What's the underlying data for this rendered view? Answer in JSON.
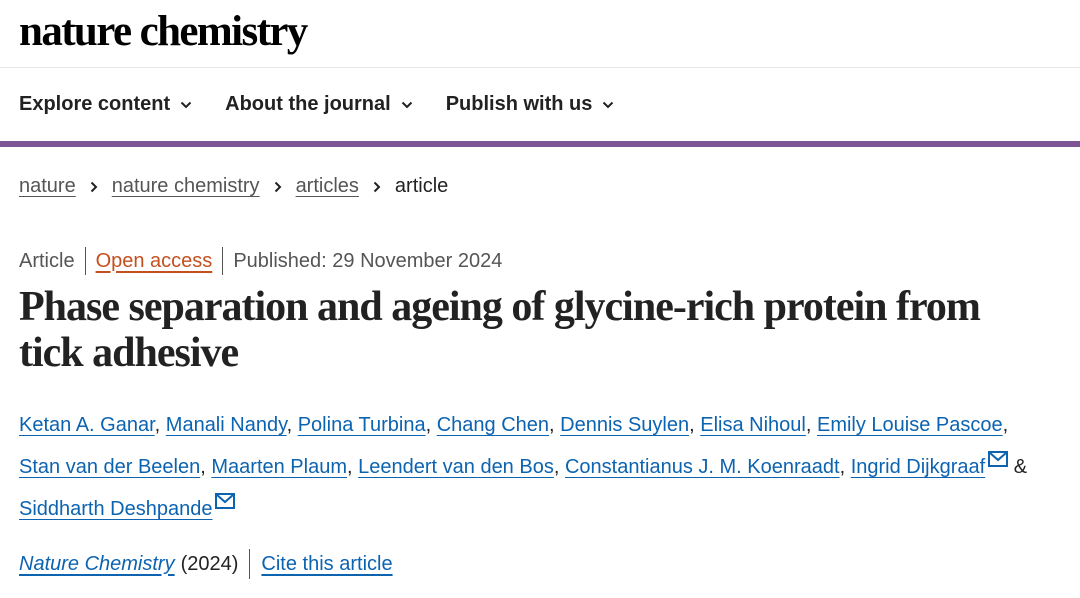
{
  "header": {
    "logo": "nature chemistry"
  },
  "nav": {
    "items": [
      {
        "label": "Explore content",
        "icon": "chevron-down-icon"
      },
      {
        "label": "About the journal",
        "icon": "chevron-down-icon"
      },
      {
        "label": "Publish with us",
        "icon": "chevron-down-icon"
      }
    ]
  },
  "breadcrumb": {
    "items": [
      {
        "label": "nature"
      },
      {
        "label": "nature chemistry"
      },
      {
        "label": "articles"
      }
    ],
    "current": "article",
    "separator_icon": "chevron-right-icon"
  },
  "article": {
    "type": "Article",
    "access": "Open access",
    "published": "Published: 29 November 2024",
    "title": "Phase separation and ageing of glycine-rich protein from tick adhesive",
    "authors": [
      {
        "name": "Ketan A. Ganar"
      },
      {
        "name": "Manali Nandy"
      },
      {
        "name": "Polina Turbina"
      },
      {
        "name": "Chang Chen"
      },
      {
        "name": "Dennis Suylen"
      },
      {
        "name": "Elisa Nihoul"
      },
      {
        "name": "Emily Louise Pascoe"
      },
      {
        "name": "Stan van der Beelen"
      },
      {
        "name": "Maarten Plaum"
      },
      {
        "name": "Leendert van den Bos"
      },
      {
        "name": "Constantianus J. M. Koenraadt"
      },
      {
        "name": "Ingrid Dijkgraaf",
        "corresponding": true
      },
      {
        "name": "Siddharth Deshpande",
        "corresponding": true
      }
    ],
    "author_separator": ", ",
    "last_author_joiner": " & ",
    "journal": "Nature Chemistry",
    "year": "(2024)",
    "cite_label": "Cite this article"
  },
  "colors": {
    "nav_accent": "#7d5596",
    "link": "#0c63b0",
    "open_access": "#c4501f",
    "text": "#222222",
    "muted": "#555555"
  }
}
